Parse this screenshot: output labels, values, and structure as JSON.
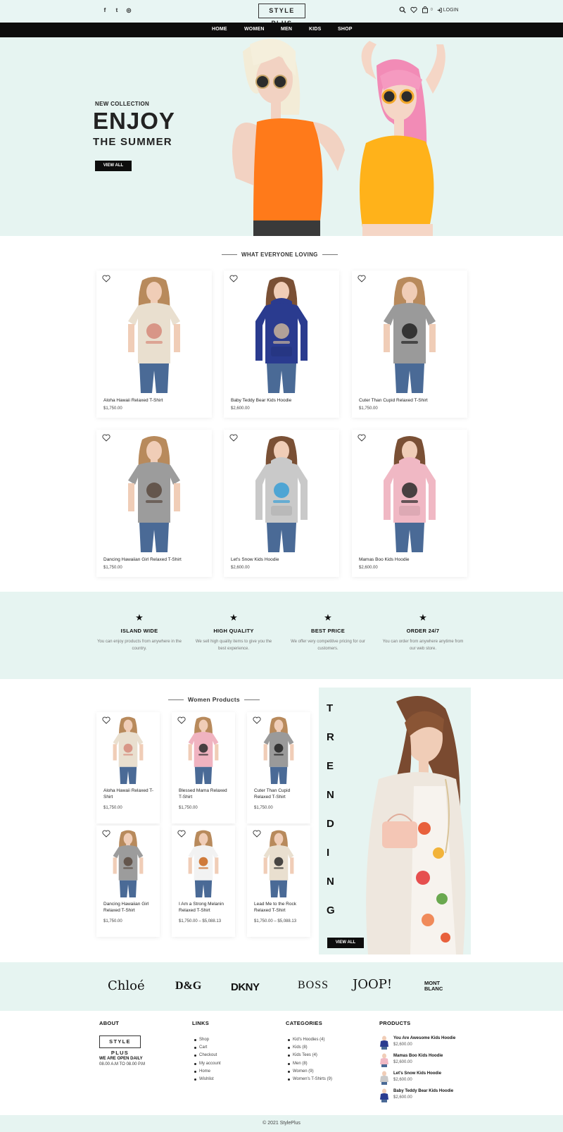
{
  "header": {
    "social": [
      {
        "icon": "facebook-icon",
        "glyph": "f"
      },
      {
        "icon": "twitter-icon",
        "glyph": "t"
      },
      {
        "icon": "instagram-icon",
        "glyph": "◎"
      }
    ],
    "logo": "STYLE PLUS",
    "cart_count": "0",
    "login_label": "LOGIN"
  },
  "nav": [
    "HOME",
    "WOMEN",
    "MEN",
    "KIDS",
    "SHOP"
  ],
  "hero": {
    "kicker": "NEW COLLECTION",
    "title": "ENJOY",
    "subtitle": "THE SUMMER",
    "button": "VIEW ALL"
  },
  "loving": {
    "title": "WHAT EVERYONE LOVING",
    "products": [
      {
        "name": "Aloha Hawaii Relaxed T-Shirt",
        "price": "$1,750.00",
        "color": "#e9dfcf",
        "print": "#d58a7a",
        "model": "woman"
      },
      {
        "name": "Baby Teddy Bear Kids Hoodie",
        "price": "$2,600.00",
        "color": "#2a3b8f",
        "print": "#c9b49a",
        "model": "kid"
      },
      {
        "name": "Cuter Than Cupid Relaxed T-Shirt",
        "price": "$1,750.00",
        "color": "#9a9a9a",
        "print": "#222222",
        "model": "woman"
      },
      {
        "name": "Dancing Hawaiian Girl Relaxed T-Shirt",
        "price": "$1,750.00",
        "color": "#9c9c9c",
        "print": "#5a4a40",
        "model": "woman"
      },
      {
        "name": "Let's Snow Kids Hoodie",
        "price": "$2,600.00",
        "color": "#c9c9c9",
        "print": "#3a9fd6",
        "model": "kid"
      },
      {
        "name": "Mamas Boo Kids Hoodie",
        "price": "$2,600.00",
        "color": "#f0b8c4",
        "print": "#2a2a2a",
        "model": "kid"
      }
    ]
  },
  "features": [
    {
      "title": "ISLAND WIDE",
      "desc": "You can enjoy products from anywhere in the country."
    },
    {
      "title": "HIGH QUALITY",
      "desc": "We sell high quality items to give you the best experience."
    },
    {
      "title": "BEST PRICE",
      "desc": "We offer very competitive pricing for our customers."
    },
    {
      "title": "ORDER 24/7",
      "desc": "You can order from anywhere anytime from our web store."
    }
  ],
  "women": {
    "title": "Women Products",
    "products": [
      {
        "name": "Aloha Hawaii Relaxed T-Shirt",
        "price": "$1,750.00",
        "color": "#e9dfcf",
        "print": "#d58a7a"
      },
      {
        "name": "Blessed Mama Relaxed T-Shirt",
        "price": "$1,750.00",
        "color": "#f0b3c0",
        "print": "#2a2a2a"
      },
      {
        "name": "Cuter Than Cupid Relaxed T-Shirt",
        "price": "$1,750.00",
        "color": "#9a9a9a",
        "print": "#222222"
      },
      {
        "name": "Dancing Hawaiian Girl Relaxed T-Shirt",
        "price": "$1,750.00",
        "color": "#9c9c9c",
        "print": "#5a4a40"
      },
      {
        "name": "I Am a Strong Melanin Relaxed T-Shirt",
        "price": "$1,750.00 – $5,088.13",
        "color": "#f2f2f2",
        "print": "#c9651a"
      },
      {
        "name": "Lead Me to the Rock Relaxed T-Shirt",
        "price": "$1,750.00 – $5,088.13",
        "color": "#e9dfcf",
        "print": "#2a2a2a"
      }
    ]
  },
  "trending": {
    "letters": [
      "T",
      "R",
      "E",
      "N",
      "D",
      "I",
      "N",
      "G"
    ],
    "button": "VIEW ALL"
  },
  "brands": [
    "Chloé",
    "D&G",
    "DKNY",
    "BOSS",
    "JOOP!",
    "MONT BLANC"
  ],
  "footer": {
    "about": {
      "title": "ABOUT",
      "logo": "STYLE PLUS",
      "open": "WE ARE OPEN DAILY",
      "hours": "08.00 A.M TO 08.00 P.M"
    },
    "links": {
      "title": "LINKS",
      "items": [
        "Shop",
        "Cart",
        "Checkout",
        "My account",
        "Home",
        "Wishlist"
      ]
    },
    "categories": {
      "title": "CATEGORIES",
      "items": [
        "Kid's Hoodies (4)",
        "Kids (8)",
        "Kids Tees (4)",
        "Men (8)",
        "Women (9)",
        "Women's T-Shirts (9)"
      ]
    },
    "products": {
      "title": "PRODUCTS",
      "items": [
        {
          "name": "You Are Awesome Kids Hoodie",
          "price": "$2,600.00",
          "color": "#2a3b8f"
        },
        {
          "name": "Mamas Boo Kids Hoodie",
          "price": "$2,600.00",
          "color": "#f0b8c4"
        },
        {
          "name": "Let's Snow Kids Hoodie",
          "price": "$2,600.00",
          "color": "#c9c9c9"
        },
        {
          "name": "Baby Teddy Bear Kids Hoodie",
          "price": "$2,600.00",
          "color": "#2a3b8f"
        }
      ]
    }
  },
  "copyright": "© 2021 StylePlus"
}
